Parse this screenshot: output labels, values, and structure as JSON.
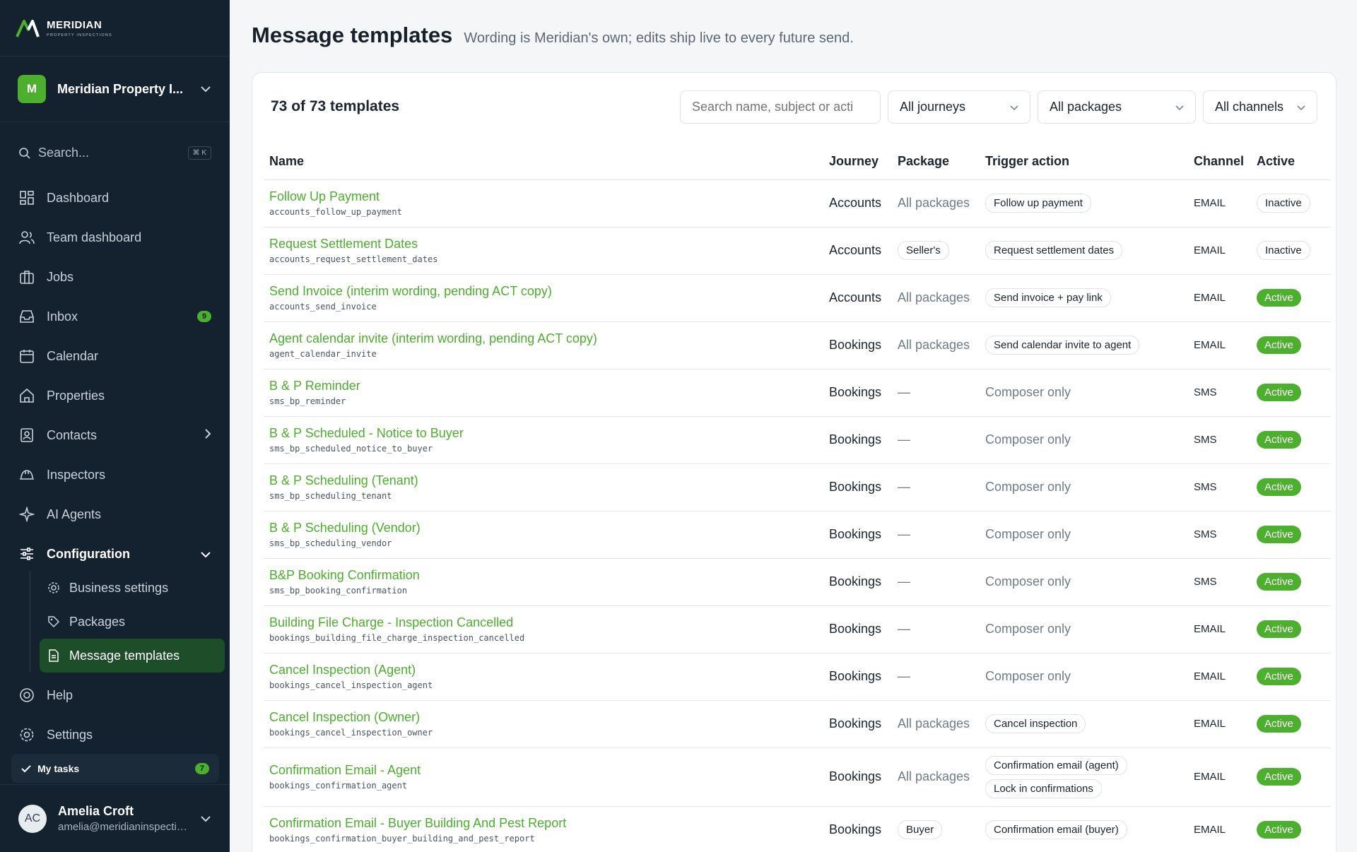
{
  "brand": {
    "name": "MERIDIAN",
    "sub": "PROPERTY INSPECTIONS"
  },
  "org": {
    "initial": "M",
    "name": "Meridian Property I..."
  },
  "search": {
    "label": "Search...",
    "shortcut": "⌘ K"
  },
  "nav": {
    "dashboard": "Dashboard",
    "team_dashboard": "Team dashboard",
    "jobs": "Jobs",
    "inbox": "Inbox",
    "inbox_count": "9",
    "calendar": "Calendar",
    "properties": "Properties",
    "contacts": "Contacts",
    "inspectors": "Inspectors",
    "ai_agents": "AI Agents",
    "configuration": "Configuration",
    "business_settings": "Business settings",
    "packages": "Packages",
    "message_templates": "Message templates",
    "help": "Help",
    "settings": "Settings"
  },
  "tasks": {
    "label": "My tasks",
    "count": "7"
  },
  "user": {
    "initials": "AC",
    "name": "Amelia Croft",
    "email": "amelia@meridianinspections.com.au"
  },
  "page": {
    "title": "Message templates",
    "subtitle": "Wording is Meridian's own; edits ship live to every future send."
  },
  "toolbar": {
    "count": "73 of 73 templates",
    "search_placeholder": "Search name, subject or acti",
    "journey": "All journeys",
    "package": "All packages",
    "channel": "All channels"
  },
  "columns": {
    "name": "Name",
    "journey": "Journey",
    "package": "Package",
    "trigger": "Trigger action",
    "channel": "Channel",
    "active": "Active"
  },
  "rows": [
    {
      "name": "Follow Up Payment",
      "slug": "accounts_follow_up_payment",
      "journey": "Accounts",
      "package": "All packages",
      "package_style": "text",
      "triggers": [
        "Follow up payment"
      ],
      "channel": "EMAIL",
      "status": "Inactive"
    },
    {
      "name": "Request Settlement Dates",
      "slug": "accounts_request_settlement_dates",
      "journey": "Accounts",
      "package": "Seller's",
      "package_style": "pill",
      "triggers": [
        "Request settlement dates"
      ],
      "channel": "EMAIL",
      "status": "Inactive"
    },
    {
      "name": "Send Invoice (interim wording, pending ACT copy)",
      "slug": "accounts_send_invoice",
      "journey": "Accounts",
      "package": "All packages",
      "package_style": "text",
      "triggers": [
        "Send invoice + pay link"
      ],
      "channel": "EMAIL",
      "status": "Active"
    },
    {
      "name": "Agent calendar invite (interim wording, pending ACT copy)",
      "slug": "agent_calendar_invite",
      "journey": "Bookings",
      "package": "All packages",
      "package_style": "text",
      "triggers": [
        "Send calendar invite to agent"
      ],
      "channel": "EMAIL",
      "status": "Active"
    },
    {
      "name": "B & P Reminder",
      "slug": "sms_bp_reminder",
      "journey": "Bookings",
      "package": "—",
      "package_style": "text",
      "triggers": [],
      "trigger_text": "Composer only",
      "channel": "SMS",
      "status": "Active"
    },
    {
      "name": "B & P Scheduled - Notice to Buyer",
      "slug": "sms_bp_scheduled_notice_to_buyer",
      "journey": "Bookings",
      "package": "—",
      "package_style": "text",
      "triggers": [],
      "trigger_text": "Composer only",
      "channel": "SMS",
      "status": "Active"
    },
    {
      "name": "B & P Scheduling (Tenant)",
      "slug": "sms_bp_scheduling_tenant",
      "journey": "Bookings",
      "package": "—",
      "package_style": "text",
      "triggers": [],
      "trigger_text": "Composer only",
      "channel": "SMS",
      "status": "Active"
    },
    {
      "name": "B & P Scheduling (Vendor)",
      "slug": "sms_bp_scheduling_vendor",
      "journey": "Bookings",
      "package": "—",
      "package_style": "text",
      "triggers": [],
      "trigger_text": "Composer only",
      "channel": "SMS",
      "status": "Active"
    },
    {
      "name": "B&P Booking Confirmation",
      "slug": "sms_bp_booking_confirmation",
      "journey": "Bookings",
      "package": "—",
      "package_style": "text",
      "triggers": [],
      "trigger_text": "Composer only",
      "channel": "SMS",
      "status": "Active"
    },
    {
      "name": "Building File Charge - Inspection Cancelled",
      "slug": "bookings_building_file_charge_inspection_cancelled",
      "journey": "Bookings",
      "package": "—",
      "package_style": "text",
      "triggers": [],
      "trigger_text": "Composer only",
      "channel": "EMAIL",
      "status": "Active"
    },
    {
      "name": "Cancel Inspection (Agent)",
      "slug": "bookings_cancel_inspection_agent",
      "journey": "Bookings",
      "package": "—",
      "package_style": "text",
      "triggers": [],
      "trigger_text": "Composer only",
      "channel": "EMAIL",
      "status": "Active"
    },
    {
      "name": "Cancel Inspection (Owner)",
      "slug": "bookings_cancel_inspection_owner",
      "journey": "Bookings",
      "package": "All packages",
      "package_style": "text",
      "triggers": [
        "Cancel inspection"
      ],
      "channel": "EMAIL",
      "status": "Active"
    },
    {
      "name": "Confirmation Email - Agent",
      "slug": "bookings_confirmation_agent",
      "journey": "Bookings",
      "package": "All packages",
      "package_style": "text",
      "triggers": [
        "Confirmation email (agent)",
        "Lock in confirmations"
      ],
      "channel": "EMAIL",
      "status": "Active"
    },
    {
      "name": "Confirmation Email - Buyer Building And Pest Report",
      "slug": "bookings_confirmation_buyer_building_and_pest_report",
      "journey": "Bookings",
      "package": "Buyer",
      "package_style": "pill",
      "triggers": [
        "Confirmation email (buyer)"
      ],
      "channel": "EMAIL",
      "status": "Active"
    }
  ]
}
